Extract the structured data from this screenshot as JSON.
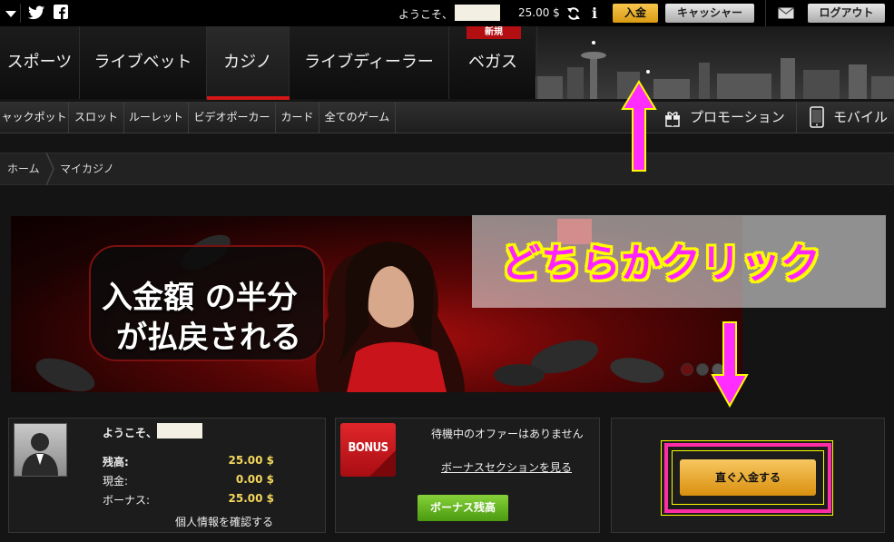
{
  "topbar": {
    "welcome": "ようこそ、",
    "balance": "25.00 $",
    "deposit_label": "入金",
    "cashier_label": "キャッシャー",
    "logout_label": "ログアウト"
  },
  "mainnav": {
    "items": [
      {
        "label": "スポーツ"
      },
      {
        "label": "ライブベット"
      },
      {
        "label": "カジノ"
      },
      {
        "label": "ライブディーラー"
      },
      {
        "label": "ベガス"
      }
    ],
    "active": "カジノ",
    "new_badge": "新規"
  },
  "subnav": {
    "items": [
      {
        "label": "ャックポット"
      },
      {
        "label": "スロット"
      },
      {
        "label": "ルーレット"
      },
      {
        "label": "ビデオポーカー"
      },
      {
        "label": "カード"
      },
      {
        "label": "全てのゲーム"
      }
    ],
    "promotions": "プロモーション",
    "mobile": "モバイル"
  },
  "breadcrumb": {
    "home": "ホーム",
    "current": "マイカジノ"
  },
  "banner": {
    "line1": "入金額 の半分",
    "line2": "が払戻される"
  },
  "annotation": {
    "text": "どちらかクリック",
    "color": "#ff22ff"
  },
  "account": {
    "welcome": "ようこそ、",
    "balance_label": "残高:",
    "balance_value": "25.00 $",
    "cash_label": "現金:",
    "cash_value": "0.00 $",
    "bonus_label": "ボーナス:",
    "bonus_value": "25.00 $",
    "profile_link": "個人情報を確認する"
  },
  "bonus_panel": {
    "icon_text": "BONUS",
    "no_offers": "待機中のオファーはありません",
    "section_link": "ボーナスセクションを見る",
    "balance_button": "ボーナス残高"
  },
  "deposit_panel": {
    "button": "直ぐ入金する"
  },
  "colors": {
    "accent_gold": "#f4c042",
    "active_red": "#d31616",
    "annotation_pink": "#ff2da5",
    "annotation_yellow": "#fffb00"
  }
}
